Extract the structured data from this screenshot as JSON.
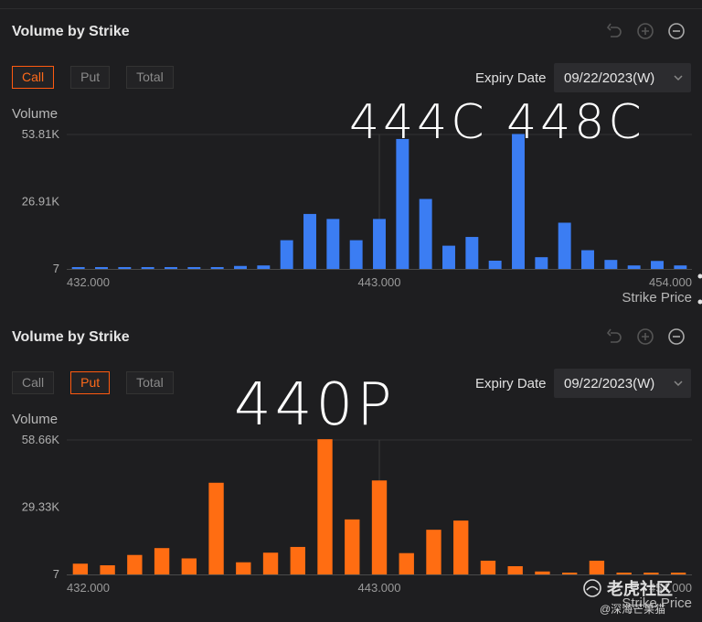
{
  "panels": [
    {
      "title": "Volume by Strike",
      "tabs": [
        "Call",
        "Put",
        "Total"
      ],
      "active_tab": "Call",
      "expiry_label": "Expiry Date",
      "expiry_value": "09/22/2023(W)",
      "annotation": "444C   448C",
      "colors": {
        "bar": "#3b7df3",
        "active_tab": "#ff6a1a"
      }
    },
    {
      "title": "Volume by Strike",
      "tabs": [
        "Call",
        "Put",
        "Total"
      ],
      "active_tab": "Put",
      "expiry_label": "Expiry Date",
      "expiry_value": "09/22/2023(W)",
      "annotation": "440P",
      "colors": {
        "bar": "#ff6d12",
        "active_tab": "#ff6a1a"
      }
    }
  ],
  "watermark": {
    "main": "老虎社区",
    "sub": "@深海芒果猫"
  },
  "chart_data": [
    {
      "type": "bar",
      "ylabel": "Volume",
      "xlabel": "Strike Price",
      "yticks": [
        "53.81K",
        "26.91K",
        "7"
      ],
      "ytick_values": [
        53810,
        26910,
        7
      ],
      "ylim": [
        7,
        53810
      ],
      "xticks": [
        "432.000",
        "443.000",
        "454.000"
      ],
      "xtick_values": [
        432,
        443,
        454
      ],
      "x": [
        432,
        433,
        434,
        435,
        436,
        437,
        438,
        439,
        440,
        441,
        442,
        443,
        444,
        445,
        446,
        447,
        448,
        449,
        450,
        451,
        452,
        453,
        454
      ],
      "values": [
        200,
        150,
        150,
        150,
        200,
        300,
        300,
        1200,
        1400,
        11500,
        22000,
        20000,
        11500,
        20000,
        52000,
        28000,
        9300,
        12800,
        3300,
        54000,
        4700,
        18500,
        7500,
        3600,
        1400,
        3200,
        1400
      ]
    },
    {
      "type": "bar",
      "ylabel": "Volume",
      "xlabel": "Strike Price",
      "yticks": [
        "58.66K",
        "29.33K",
        "7"
      ],
      "ytick_values": [
        58660,
        29330,
        7
      ],
      "ylim": [
        7,
        58660
      ],
      "xticks": [
        "432.000",
        "443.000",
        "454.000"
      ],
      "xtick_values": [
        432,
        443,
        454
      ],
      "x": [
        432,
        433,
        434,
        435,
        436,
        437,
        438,
        439,
        440,
        441,
        442,
        443,
        444,
        445,
        446,
        447,
        448,
        449,
        450,
        451,
        452,
        453,
        454
      ],
      "values": [
        4700,
        4000,
        8500,
        11500,
        7000,
        40000,
        5300,
        9500,
        12000,
        59000,
        24000,
        41000,
        9300,
        19500,
        23500,
        6000,
        3600,
        1300,
        600,
        6000,
        300,
        300,
        300
      ]
    }
  ]
}
